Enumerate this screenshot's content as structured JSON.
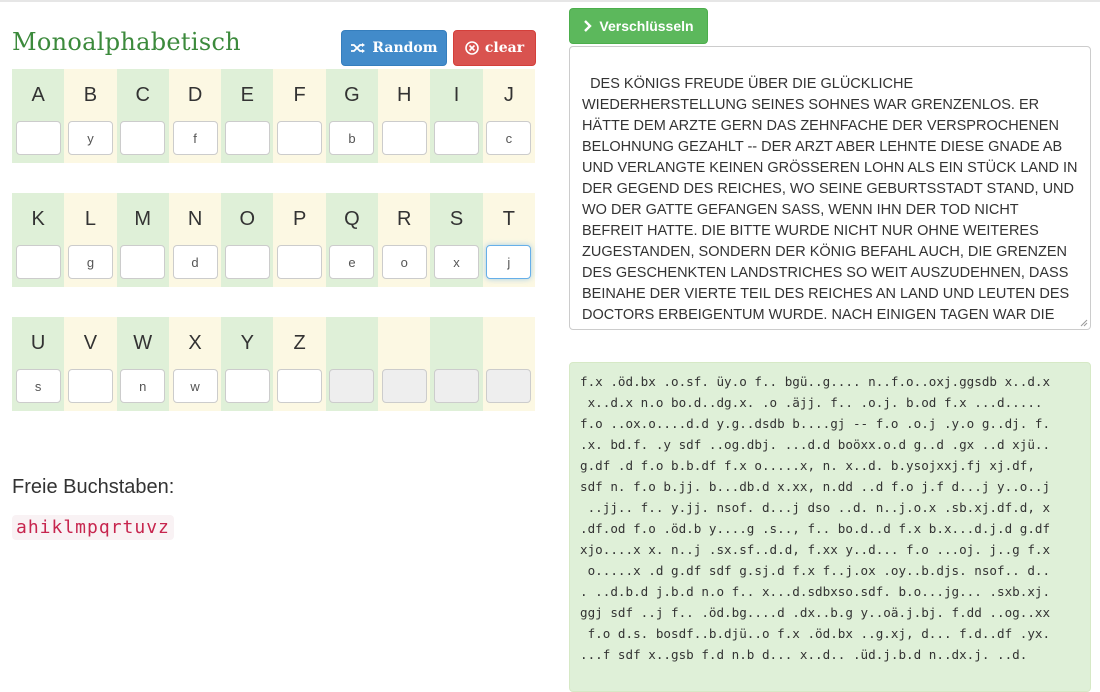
{
  "title": "Monoalphabetisch",
  "buttons": {
    "random": "Random",
    "clear": "clear",
    "encrypt": "Verschlüsseln"
  },
  "rows": [
    {
      "letters": [
        "A",
        "B",
        "C",
        "D",
        "E",
        "F",
        "G",
        "H",
        "I",
        "J"
      ],
      "values": [
        "",
        "y",
        "",
        "f",
        "",
        "",
        "b",
        "",
        "",
        "c"
      ]
    },
    {
      "letters": [
        "K",
        "L",
        "M",
        "N",
        "O",
        "P",
        "Q",
        "R",
        "S",
        "T"
      ],
      "values": [
        "",
        "g",
        "",
        "d",
        "",
        "",
        "e",
        "o",
        "x",
        "j"
      ]
    },
    {
      "letters": [
        "U",
        "V",
        "W",
        "X",
        "Y",
        "Z",
        "",
        "",
        "",
        ""
      ],
      "values": [
        "s",
        "",
        "n",
        "w",
        "",
        "",
        "",
        "",
        "",
        ""
      ]
    }
  ],
  "free": {
    "label": "Freie Buchstaben:",
    "letters": "ahiklmpqrtuvz"
  },
  "plaintext": "DES KÖNIGS FREUDE ÜBER DIE GLÜCKLICHE WIEDERHERSTELLUNG SEINES SOHNES WAR GRENZENLOS. ER HÄTTE DEM ARZTE GERN DAS ZEHNFACHE DER VERSPROCHENEN BELOHNUNG GEZAHLT -- DER ARZT ABER LEHNTE DIESE GNADE AB UND VERLANGTE KEINEN GRÖSSEREN LOHN ALS EIN STÜCK LAND IN DER GEGEND DES REICHES, WO SEINE GEBURTSSTADT STAND, UND WO DER GATTE GEFANGEN SASS, WENN IHN DER TOD NICHT BEFREIT HATTE. DIE BITTE WURDE NICHT NUR OHNE WEITERES ZUGESTANDEN, SONDERN DER KÖNIG BEFAHL AUCH, DIE GRENZEN DES GESCHENKTEN LANDSTRICHES SO WEIT AUSZUDEHNEN, DASS BEINAHE DER VIERTE TEIL DES REICHES AN LAND UND LEUTEN DES DOCTORS ERBEIGENTUM WURDE. NACH EINIGEN TAGEN WAR DIE SCHENKUNGSURKUNDE GERICHTLICH AUSGESTELLT UND MIT DEM KÖNIGLICHEN INSIEGEL BEKRÄFTIGT. DANN VERLIESS DER NEUE",
  "ciphertext": "f.x .öd.bx .o.sf. üy.o f.. bgü..g.... n..f.o..oxj.ggsdb x..d.x\n x..d.x n.o bo.d..dg.x. .o .äjj. f.. .o.j. b.od f.x ...d.....\nf.o ..ox.o....d.d y.g..dsdb b....gj -- f.o .o.j .y.o g..dj. f.\n.x. bd.f. .y sdf ..og.dbj. ...d.d boöxx.o.d g..d .gx ..d xjü..\ng.df .d f.o b.b.df f.x o.....x, n. x..d. b.ysojxxj.fj xj.df,\nsdf n. f.o b.jj. b...db.d x.xx, n.dd ..d f.o j.f d...j y..o..j\n ..jj.. f.. y.jj. nsof. d...j dso ..d. n..j.o.x .sb.xj.df.d, x\n.df.od f.o .öd.b y....g .s.., f.. bo.d..d f.x b.x...d.j.d g.df\nxjo....x x. n..j .sx.sf..d.d, f.xx y..d... f.o ...oj. j..g f.x\n o.....x .d g.df sdf g.sj.d f.x f..j.ox .oy..b.djs. nsof.. d..\n. ..d.b.d j.b.d n.o f.. x...d.sdbxso.sdf. b.o...jg... .sxb.xj.\nggj sdf ..j f.. .öd.bg....d .dx..b.g y..oä.j.bj. f.dd ..og..xx\n f.o d.s. bosdf..b.djü..o f.x .öd.bx ..g.xj, d... f.d..df .yx.\n...f sdf x..gsb f.d n.b d... x..d.. .üd.j.b.d n..dx.j. ..d."
}
